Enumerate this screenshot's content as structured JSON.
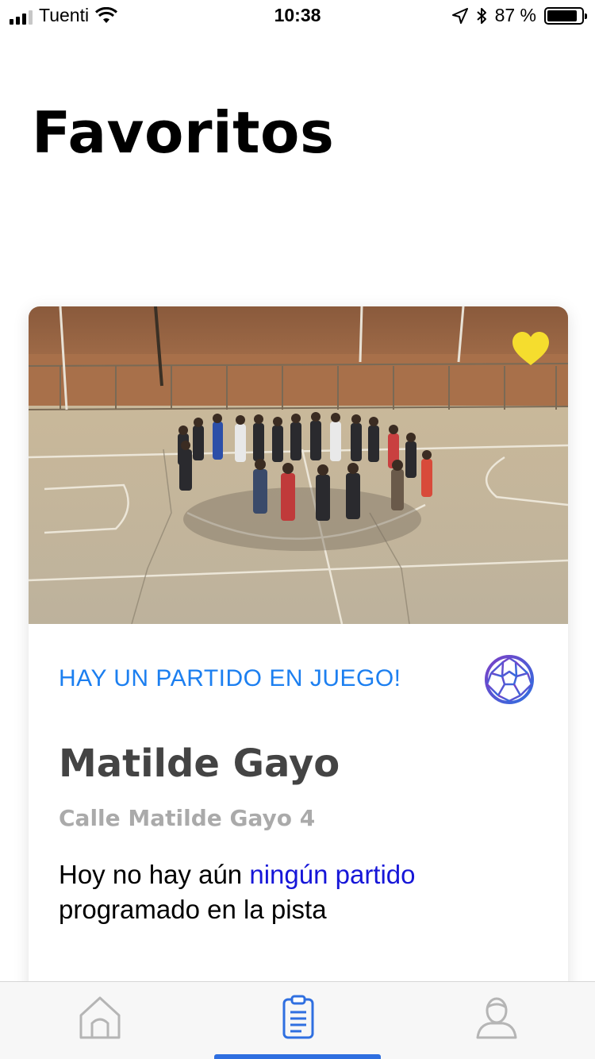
{
  "status_bar": {
    "carrier": "Tuenti",
    "time": "10:38",
    "battery_percent": "87 %",
    "battery_level": 0.87,
    "icons": [
      "signal-icon",
      "wifi-icon",
      "location-arrow-icon",
      "bluetooth-icon",
      "battery-icon"
    ]
  },
  "page": {
    "title": "Favoritos"
  },
  "card": {
    "favorite": true,
    "favorite_color": "#F5DD2E",
    "live_banner": "HAY UN PARTIDO EN JUEGO!",
    "live_color": "#1C7FF0",
    "venue_name": "Matilde Gayo",
    "venue_address": "Calle Matilde Gayo 4",
    "message_before": "Hoy no hay aún ",
    "message_link": "ningún partido",
    "message_after": "programado en la pista",
    "link_color": "#1616D8"
  },
  "tab_bar": {
    "tabs": [
      {
        "icon": "home-icon",
        "active": false
      },
      {
        "icon": "clipboard-icon",
        "active": true
      },
      {
        "icon": "profile-icon",
        "active": false
      }
    ],
    "active_color": "#2F6FE0"
  }
}
